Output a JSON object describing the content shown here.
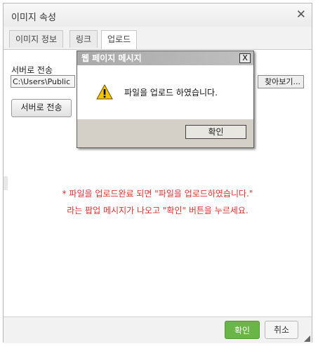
{
  "dialog": {
    "title": "이미지 속성",
    "close_icon": "close-icon",
    "tabs": [
      {
        "label": "이미지 정보",
        "active": false
      },
      {
        "label": "링크",
        "active": false
      },
      {
        "label": "업로드",
        "active": true
      }
    ],
    "upload": {
      "label": "서버로 전송",
      "file_value": "C:\\Users\\Public",
      "browse_label": "찾아보기...",
      "send_button": "서버로 전송"
    },
    "notice_line1": "* 파일을 업로드완료 되면 \"파일을 업로드하였습니다.\"",
    "notice_line2": "라는 팝업 메시지가 나오고 \"확인\" 버튼을 누르세요.",
    "ok_button": "확인",
    "cancel_button": "취소"
  },
  "message_box": {
    "title": "웹 페이지 메시지",
    "close_label": "X",
    "icon": "warning-icon",
    "text": "파일을 업로드 하였습니다.",
    "ok_button": "확인"
  },
  "colors": {
    "accent_green": "#6ab547",
    "notice_red": "#e03030"
  }
}
